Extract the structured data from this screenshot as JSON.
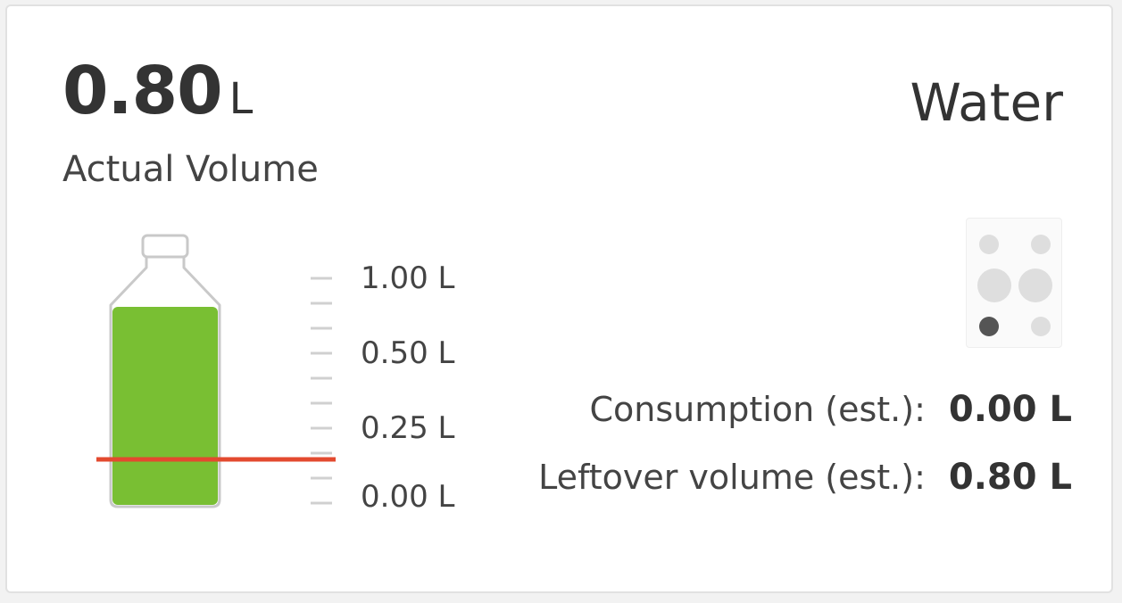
{
  "card": {
    "actual_volume": {
      "value": "0.80",
      "unit": "L",
      "label": "Actual Volume"
    },
    "liquid_name": "Water",
    "fill_level_liters": 0.8,
    "marker_level_liters": 0.08,
    "scale": {
      "labels": [
        "1.00 L",
        "0.50 L",
        "0.25 L",
        "0.00 L"
      ]
    },
    "stats": {
      "consumption_label": "Consumption (est.):",
      "consumption_value": "0.00 L",
      "leftover_label": "Leftover volume (est.):",
      "leftover_value": "0.80 L"
    },
    "indicator": {
      "active_position": "bottom-left"
    },
    "colors": {
      "liquid": "#79bf33",
      "marker": "#e34a2f",
      "bottle_outline": "#c9c9c9",
      "tick": "#d0d0d0",
      "dot_inactive": "#dedede",
      "dot_active": "#555555"
    }
  }
}
